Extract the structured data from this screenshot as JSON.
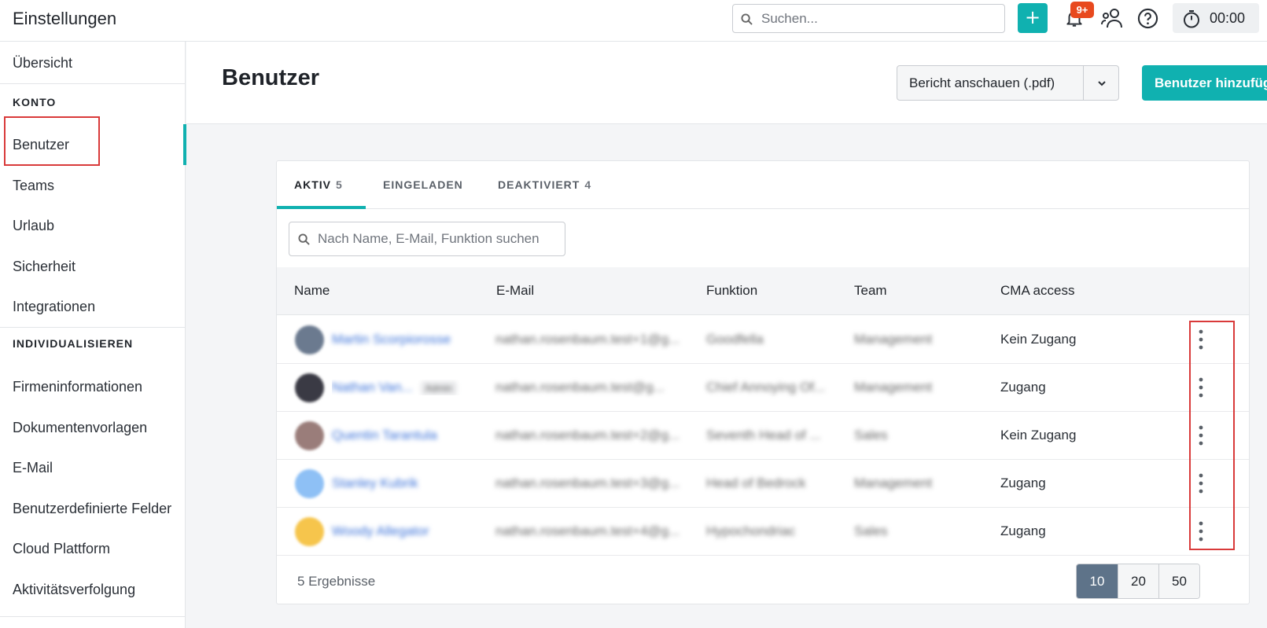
{
  "app": {
    "title": "Einstellungen"
  },
  "topbar": {
    "search_placeholder": "Suchen...",
    "plus_label": "+",
    "notification_badge": "9+",
    "timer": "00:00"
  },
  "sidebar": {
    "overview": "Übersicht",
    "section_account": "KONTO",
    "account_items": [
      "Benutzer",
      "Teams",
      "Urlaub",
      "Sicherheit",
      "Integrationen"
    ],
    "section_customize": "INDIVIDUALISIEREN",
    "customize_items": [
      "Firmeninformationen",
      "Dokumentenvorlagen",
      "E-Mail",
      "Benutzerdefinierte Felder",
      "Cloud Plattform",
      "Aktivitätsverfolgung"
    ],
    "active_item": "Benutzer"
  },
  "header": {
    "title": "Benutzer",
    "report_button": "Bericht anschauen (.pdf)",
    "add_button": "Benutzer hinzufügen"
  },
  "tabs": [
    {
      "label": "AKTIV",
      "count": "5"
    },
    {
      "label": "EINGELADEN",
      "count": ""
    },
    {
      "label": "DEAKTIVIERT",
      "count": "4"
    }
  ],
  "filter": {
    "placeholder": "Nach Name, E-Mail, Funktion suchen"
  },
  "table": {
    "columns": [
      "Name",
      "E-Mail",
      "Funktion",
      "Team",
      "CMA access"
    ],
    "rows": [
      {
        "name": "Martin Scorpiorosse",
        "email": "nathan.rosenbaum.test+1@g...",
        "function": "Goodfella",
        "team": "Management",
        "access": "Kein Zugang",
        "avatar_color": "#6b7a8f",
        "badge": ""
      },
      {
        "name": "Nathan Van...",
        "email": "nathan.rosenbaum.test@g...",
        "function": "Chief Annoying Of...",
        "team": "Management",
        "access": "Zugang",
        "avatar_color": "#3a3a44",
        "badge": "Admin"
      },
      {
        "name": "Quentin Tarantula",
        "email": "nathan.rosenbaum.test+2@g...",
        "function": "Seventh Head of ...",
        "team": "Sales",
        "access": "Kein Zugang",
        "avatar_color": "#9a7d7a",
        "badge": ""
      },
      {
        "name": "Stanley Kubrik",
        "email": "nathan.rosenbaum.test+3@g...",
        "function": "Head of Bedrock",
        "team": "Management",
        "access": "Zugang",
        "avatar_color": "#8ec0f5",
        "badge": ""
      },
      {
        "name": "Woody Allegator",
        "email": "nathan.rosenbaum.test+4@g...",
        "function": "Hypochondriac",
        "team": "Sales",
        "access": "Zugang",
        "avatar_color": "#f6c54c",
        "badge": ""
      }
    ]
  },
  "footer": {
    "result_count": "5 Ergebnisse",
    "page_sizes": [
      "10",
      "20",
      "50"
    ],
    "selected_page_size": "10"
  },
  "colors": {
    "accent": "#10b1b0",
    "badge": "#e8491e",
    "highlight": "#d93a3a"
  }
}
